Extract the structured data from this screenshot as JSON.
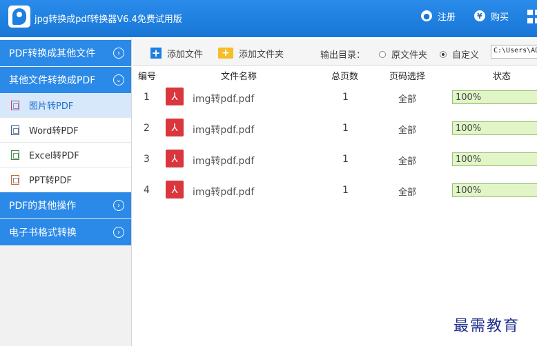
{
  "app": {
    "title": "jpg转换成pdf转换器V6.4免费试用版"
  },
  "titlebar": {
    "register_label": "注册",
    "buy_label": "购买",
    "register_icon": "user-icon",
    "buy_icon": "yen-icon",
    "menu_icon": "grid-menu-icon"
  },
  "sidebar": {
    "categories": [
      {
        "label": "PDF转换成其他文件",
        "state": "collapsed"
      },
      {
        "label": "其他文件转换成PDF",
        "state": "expanded"
      },
      {
        "label": "PDF的其他操作",
        "state": "collapsed"
      },
      {
        "label": "电子书格式转换",
        "state": "collapsed"
      }
    ],
    "subitems": [
      {
        "label": "图片转PDF",
        "icon": "image-file-icon",
        "active": true
      },
      {
        "label": "Word转PDF",
        "icon": "word-file-icon",
        "active": false
      },
      {
        "label": "Excel转PDF",
        "icon": "excel-file-icon",
        "active": false
      },
      {
        "label": "PPT转PDF",
        "icon": "ppt-file-icon",
        "active": false
      }
    ]
  },
  "toolbar": {
    "add_file_label": "添加文件",
    "add_folder_label": "添加文件夹",
    "output_dir_label": "输出目录：",
    "radio_original_label": "原文件夹",
    "radio_custom_label": "自定义",
    "selected_radio": "自定义",
    "path_value": "C:\\Users\\AD"
  },
  "table": {
    "headers": {
      "index": "编号",
      "filename": "文件名称",
      "total_pages": "总页数",
      "page_range": "页码选择",
      "status": "状态"
    },
    "rows": [
      {
        "index": "1",
        "filename": "img转pdf.pdf",
        "pages": "1",
        "range": "全部",
        "status": "100%",
        "progress": 1.0
      },
      {
        "index": "2",
        "filename": "img转pdf.pdf",
        "pages": "1",
        "range": "全部",
        "status": "100%",
        "progress": 1.0
      },
      {
        "index": "3",
        "filename": "img转pdf.pdf",
        "pages": "1",
        "range": "全部",
        "status": "100%",
        "progress": 1.0
      },
      {
        "index": "4",
        "filename": "img转pdf.pdf",
        "pages": "1",
        "range": "全部",
        "status": "100%",
        "progress": 1.0
      }
    ]
  },
  "watermark": {
    "text": "最需教育"
  },
  "colors": {
    "accent": "#2b89e8",
    "titlebar": "#1877d6",
    "progress_fill": "#e1f5c7",
    "active_item": "#d7e8fb"
  }
}
